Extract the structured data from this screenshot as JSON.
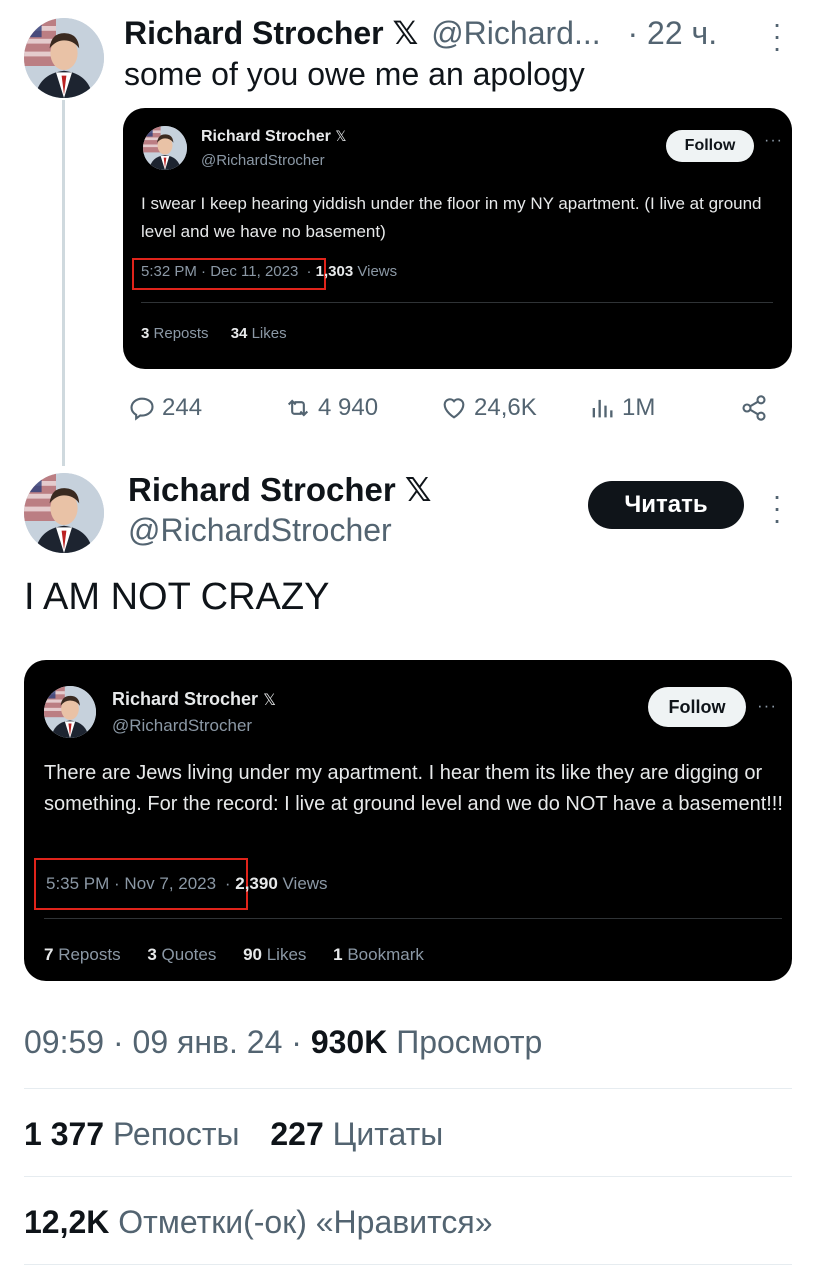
{
  "tweet": {
    "author_name": "Richard Strocher",
    "x_badge": "𝕏",
    "handle": "@Richard...",
    "time": "· 22 ч.",
    "text": "some of you owe me an apology",
    "embed": {
      "name": "Richard Strocher",
      "x_badge": "𝕏",
      "handle": "@RichardStrocher",
      "follow_label": "Follow",
      "text": "I swear I keep hearing yiddish under the floor in my NY apartment. (I live at ground level and we have no basement)",
      "timestamp": "5:32 PM · Dec 11, 2023",
      "views_count": "1,303",
      "views_label": "Views",
      "reposts_count": "3",
      "reposts_label": "Reposts",
      "likes_count": "34",
      "likes_label": "Likes"
    },
    "actions": {
      "replies": "244",
      "reposts": "4 940",
      "likes": "24,6K",
      "views": "1M"
    }
  },
  "main": {
    "author_name": "Richard Strocher",
    "x_badge": "𝕏",
    "handle": "@RichardStrocher",
    "follow_label": "Читать",
    "text": "I AM NOT CRAZY",
    "embed": {
      "name": "Richard Strocher",
      "x_badge": "𝕏",
      "handle": "@RichardStrocher",
      "follow_label": "Follow",
      "text": "There are Jews living under my apartment. I hear them its like they are digging or something. For the record: I live at ground level and we do NOT have a basement!!!",
      "timestamp": "5:35 PM · Nov 7, 2023",
      "views_count": "2,390",
      "views_label": "Views",
      "reposts_count": "7",
      "reposts_label": "Reposts",
      "quotes_count": "3",
      "quotes_label": "Quotes",
      "likes_count": "90",
      "likes_label": "Likes",
      "bookmarks_count": "1",
      "bookmarks_label": "Bookmark"
    },
    "meta_time": "09:59 · 09 янв. 24 · ",
    "meta_views": "930K",
    "meta_views_label": " Просмотр",
    "reposts_count": "1 377",
    "reposts_label": " Репосты",
    "quotes_count": "227",
    "quotes_label": " Цитаты",
    "likes_count": "12,2K",
    "likes_label": " Отметки(-ок) «Нравится»"
  },
  "colors": {
    "highlight_box": "#e0241b",
    "card_bg": "#000000",
    "text": "#0f1419",
    "muted": "#536471"
  }
}
